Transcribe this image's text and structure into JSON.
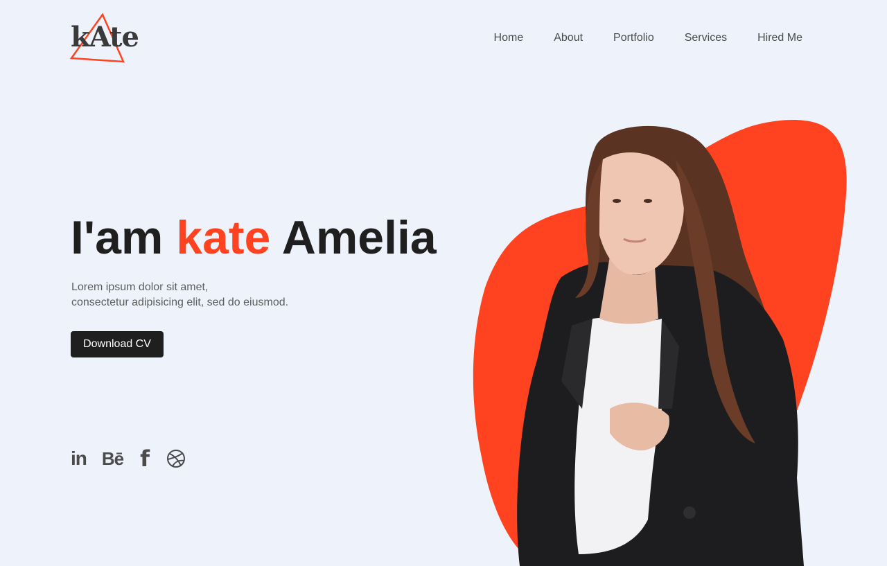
{
  "brand": {
    "logo_text": "kAte",
    "accent_color": "#ff4320"
  },
  "nav": {
    "items": [
      {
        "label": "Home"
      },
      {
        "label": "About"
      },
      {
        "label": "Portfolio"
      },
      {
        "label": "Services"
      },
      {
        "label": "Hired Me"
      }
    ]
  },
  "hero": {
    "title_prefix": "I'am",
    "title_accent": "kate",
    "title_suffix": "Amelia",
    "description_line1": "Lorem ipsum dolor sit amet,",
    "description_line2": "consectetur adipisicing elit, sed do eiusmod.",
    "cta_label": "Download CV"
  },
  "social": {
    "linkedin": "in",
    "behance": "Bē",
    "facebook": "f",
    "icons": [
      "linkedin-icon",
      "behance-icon",
      "facebook-icon",
      "dribbble-icon"
    ]
  },
  "colors": {
    "background": "#eef2fb",
    "dark": "#1f1f1f",
    "accent": "#ff4320"
  }
}
